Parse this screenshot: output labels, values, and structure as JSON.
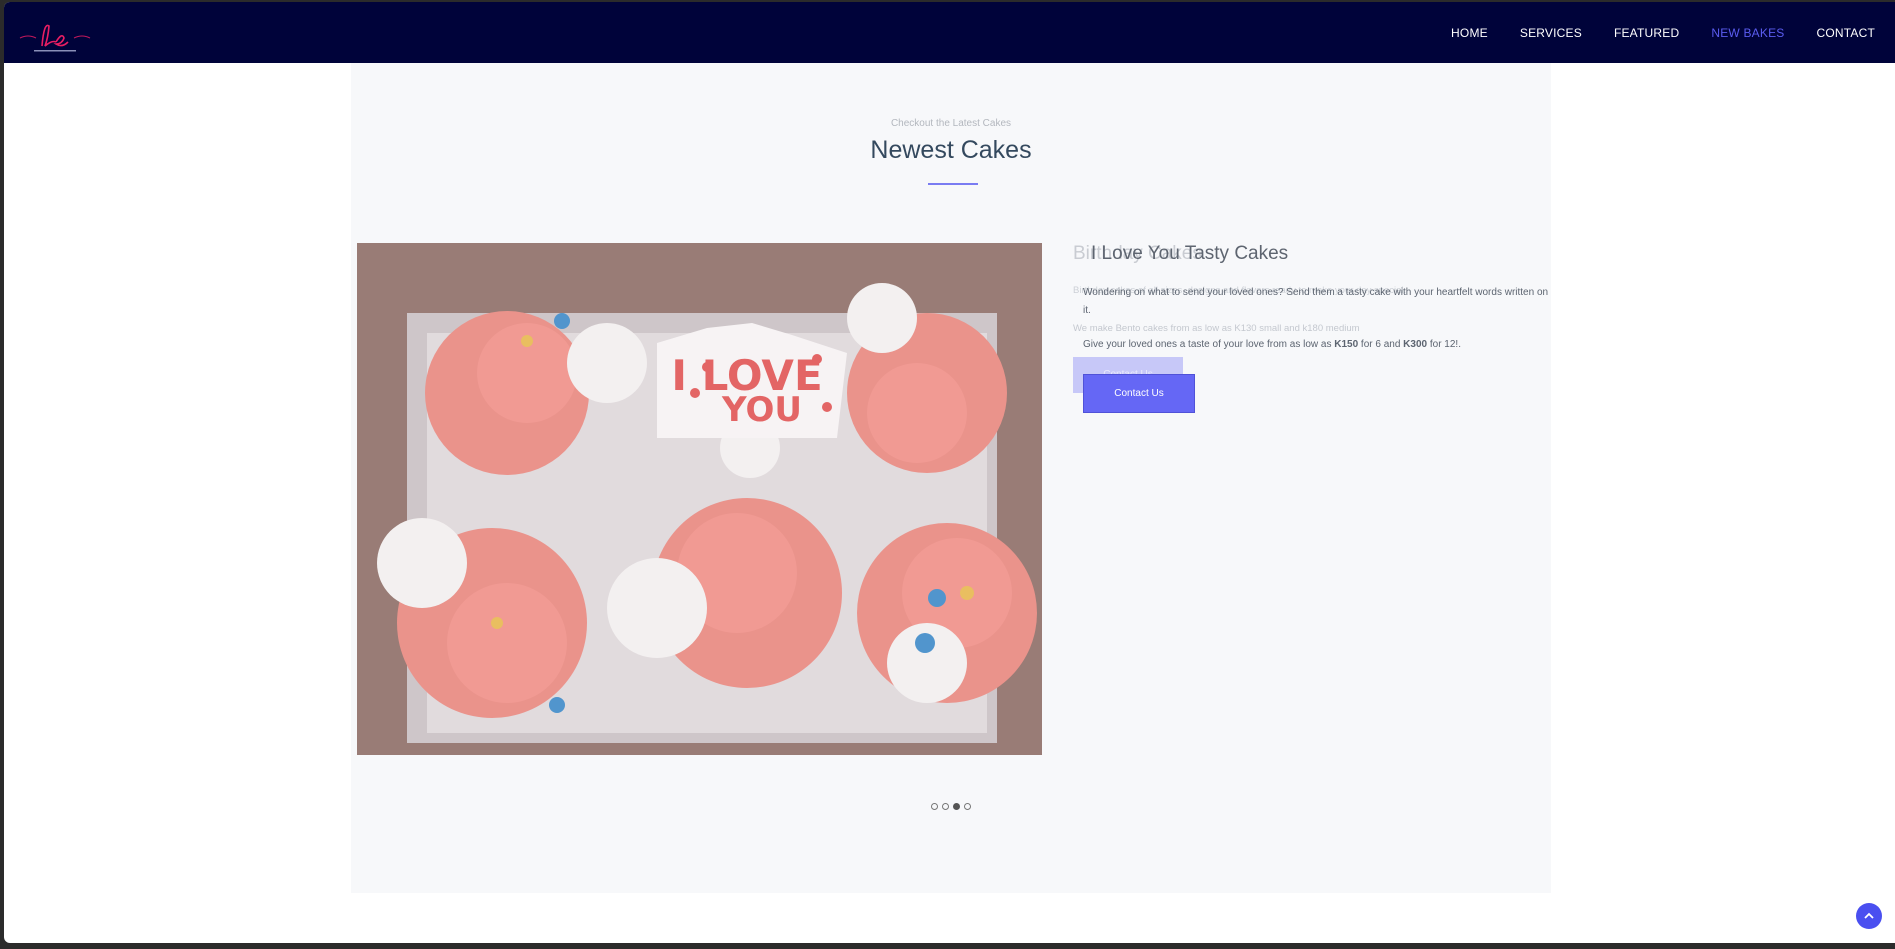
{
  "nav": {
    "links": [
      {
        "label": "HOME"
      },
      {
        "label": "SERVICES"
      },
      {
        "label": "FEATURED"
      },
      {
        "label": "NEW BAKES"
      },
      {
        "label": "CONTACT"
      }
    ],
    "active": "NEW BAKES"
  },
  "section": {
    "subtitle": "Checkout the Latest Cakes",
    "title": "Newest Cakes"
  },
  "ghost_slide": {
    "title": "Birthday Cakes",
    "text": "Birthday cakes of all sizes, designs and flavors ready to make your day special.",
    "price_text": "We make Bento cakes from as low as K130 small and k180 medium",
    "button": "Contact Us"
  },
  "slide": {
    "title": "I Love You Tasty Cakes",
    "description": "Wondering on what to send your loved ones? Send them a tasty cake with your heartfelt words written on it.",
    "price_prefix": "Give your loved ones a taste of your love from as low as ",
    "price_6": "K150",
    "price_mid": " for 6 and ",
    "price_12": "K300",
    "price_suffix": " for 12!.",
    "button": "Contact Us",
    "image_text": "I LOVE YOU"
  },
  "carousel": {
    "count": 4,
    "active_index": 2
  },
  "colors": {
    "navbar": "#00033a",
    "accent": "#6567f5",
    "active_link": "#5a5cf0"
  },
  "icons": {
    "scroll_top": "chevron-up-icon"
  }
}
